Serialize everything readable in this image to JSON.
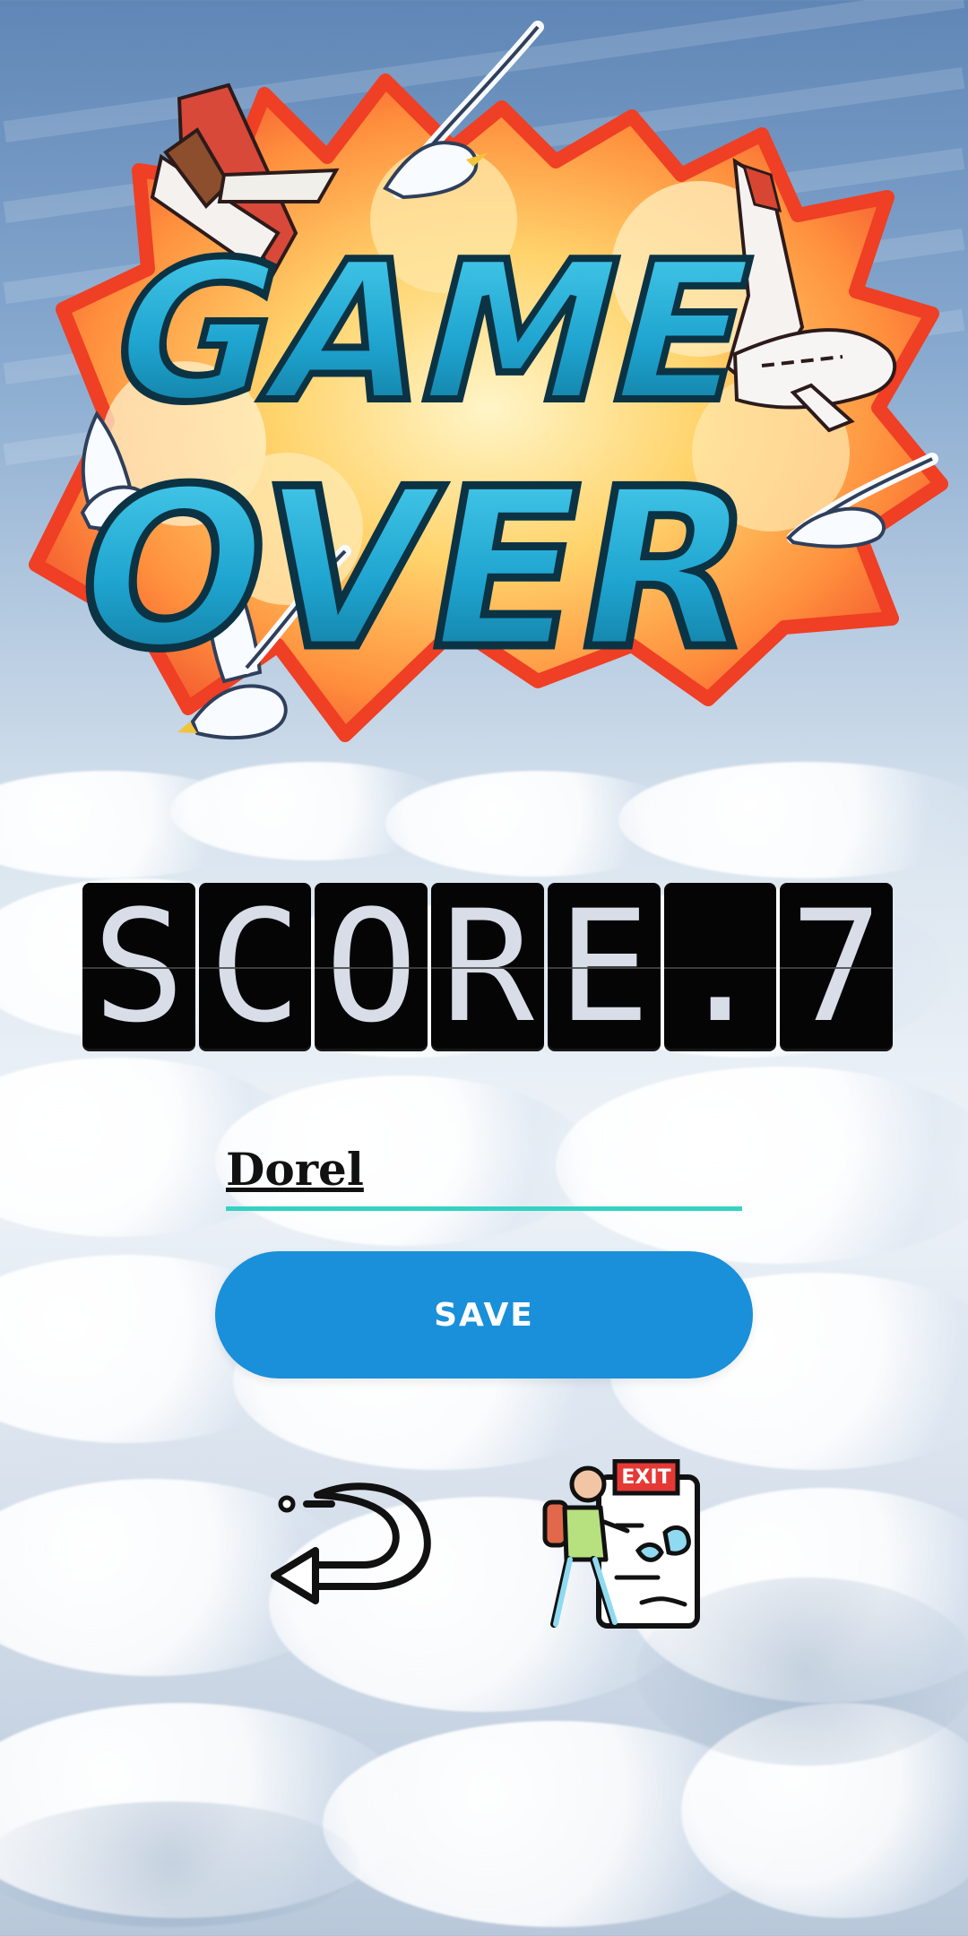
{
  "logo": {
    "line1": "GAME",
    "line2": "OVER"
  },
  "score": {
    "characters": [
      "S",
      "C",
      "O",
      "R",
      "E",
      ".",
      "7"
    ]
  },
  "player_name": {
    "value": "Dorel"
  },
  "save_button": {
    "label": "SAVE"
  },
  "exit_icon": {
    "label": "EXIT"
  },
  "icons": {
    "restart": "restart-arrow-icon",
    "exit": "exit-door-icon"
  }
}
